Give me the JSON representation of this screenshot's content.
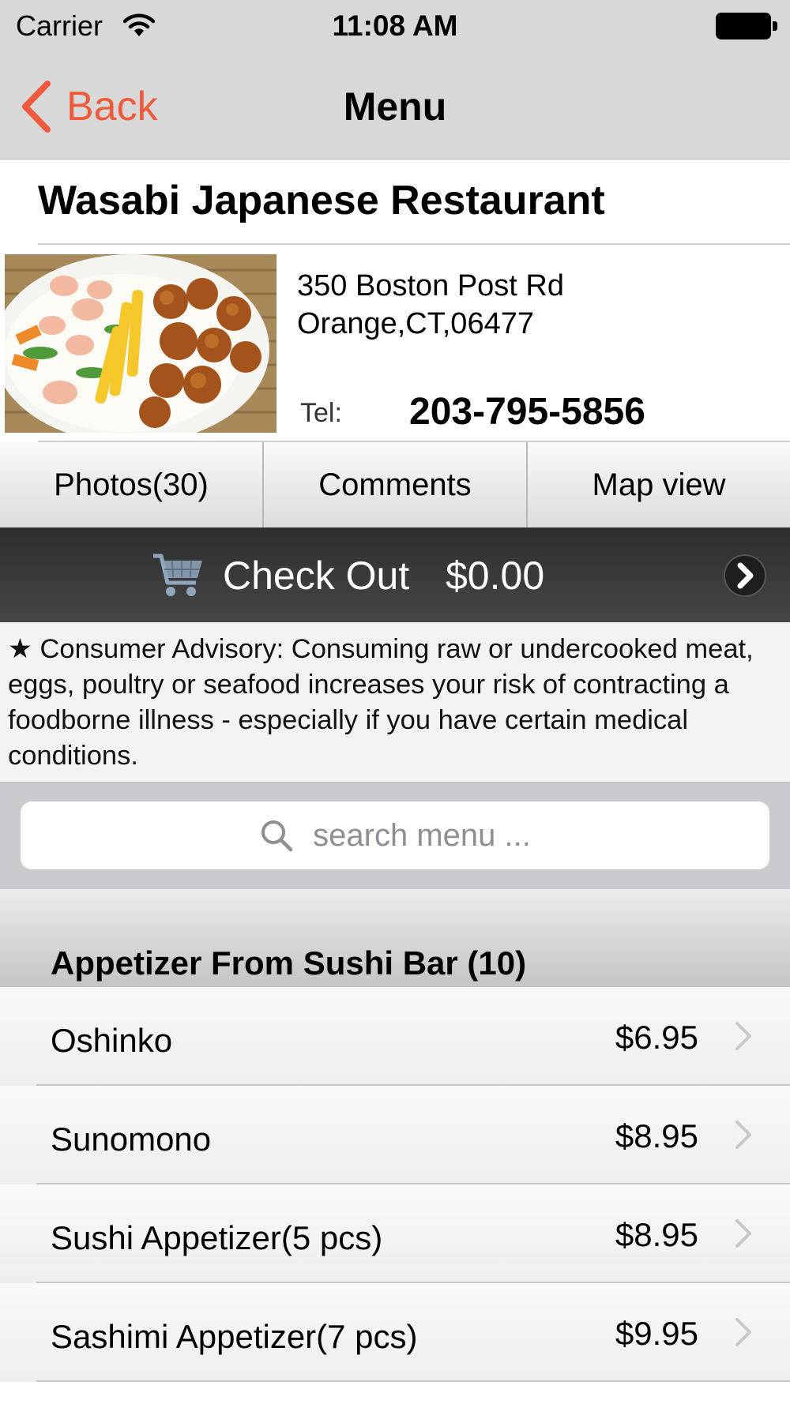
{
  "status_bar": {
    "carrier": "Carrier",
    "time": "11:08 AM"
  },
  "nav": {
    "back_label": "Back",
    "title": "Menu"
  },
  "restaurant": {
    "name": "Wasabi Japanese Restaurant",
    "address_line1": "350 Boston Post Rd",
    "address_line2": "Orange,CT,06477",
    "tel_label": "Tel:",
    "tel_number": "203-795-5856"
  },
  "tabs": [
    {
      "label": "Photos(30)"
    },
    {
      "label": "Comments"
    },
    {
      "label": "Map view"
    }
  ],
  "checkout": {
    "label": "Check Out",
    "total": "$0.00"
  },
  "advisory": "★ Consumer Advisory: Consuming raw or undercooked meat, eggs, poultry or seafood increases your risk of contracting a foodborne illness - especially if you have certain medical conditions.",
  "search": {
    "placeholder": "search menu ..."
  },
  "section": {
    "title": "Appetizer From Sushi Bar (10)"
  },
  "menu_items": [
    {
      "name": "Oshinko",
      "price": "$6.95"
    },
    {
      "name": "Sunomono",
      "price": "$8.95"
    },
    {
      "name": "Sushi Appetizer(5 pcs)",
      "price": "$8.95"
    },
    {
      "name": "Sashimi Appetizer(7 pcs)",
      "price": "$9.95"
    }
  ],
  "colors": {
    "accent": "#f05a3c",
    "checkout_bg": "#3a3a3a",
    "search_bg": "#c9c9ce"
  }
}
